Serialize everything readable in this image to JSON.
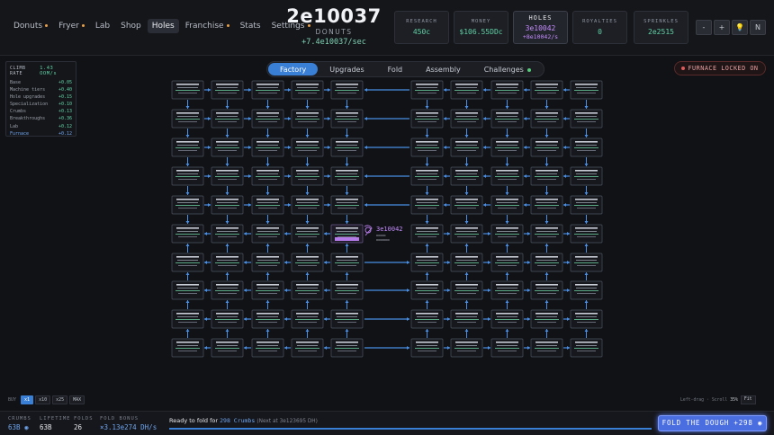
{
  "nav": [
    {
      "label": "Donuts",
      "dot": true
    },
    {
      "label": "Fryer",
      "dot": true
    },
    {
      "label": "Lab",
      "dot": false
    },
    {
      "label": "Shop",
      "dot": false
    },
    {
      "label": "Holes",
      "dot": false,
      "active": true
    },
    {
      "label": "Franchise",
      "dot": true
    },
    {
      "label": "Stats",
      "dot": false
    },
    {
      "label": "Settings",
      "dot": true
    }
  ],
  "counter": {
    "value": "2e10037",
    "unit": "DONUTS",
    "rate": "+7.4e10037/sec"
  },
  "stats": {
    "research": {
      "label": "RESEARCH",
      "value": "450c"
    },
    "money": {
      "label": "MONEY",
      "value": "$106.55DDc"
    },
    "holes": {
      "label": "HOLES",
      "value": "3e10042",
      "sub": "+8e10042/s"
    },
    "royalties": {
      "label": "ROYALTIES",
      "value": "0"
    },
    "sprinkles": {
      "label": "SPRINKLES",
      "value": "2e2515"
    }
  },
  "controls": [
    "-",
    "+",
    "💡",
    "N"
  ],
  "tabs": [
    {
      "label": "Factory",
      "active": true
    },
    {
      "label": "Upgrades"
    },
    {
      "label": "Fold"
    },
    {
      "label": "Assembly"
    },
    {
      "label": "Challenges",
      "dot": true
    }
  ],
  "furnace": {
    "label": "FURNACE LOCKED ON"
  },
  "climb": {
    "title": "CLIMB RATE",
    "rate": "1.43 OOM/s",
    "rows": [
      {
        "k": "Base",
        "v": "+0.05"
      },
      {
        "k": "Machine tiers",
        "v": "+0.40"
      },
      {
        "k": "Hole upgrades",
        "v": "+0.15"
      },
      {
        "k": "Specialization",
        "v": "+0.10"
      },
      {
        "k": "Crumbs",
        "v": "+0.13"
      },
      {
        "k": "Breakthroughs",
        "v": "+0.36"
      },
      {
        "k": "Lab",
        "v": "+0.12"
      },
      {
        "k": "Furnace",
        "v": "+0.12",
        "hl": true
      }
    ]
  },
  "center": {
    "value": "3e10042"
  },
  "buy": {
    "label": "BUY",
    "options": [
      "x1",
      "x10",
      "x25",
      "MAX"
    ],
    "active": "x1"
  },
  "view": {
    "left_drag": "Left-drag",
    "scroll": "Scroll",
    "zoom": "35%",
    "fit": "Fit"
  },
  "bottom": {
    "crumbs": {
      "label": "CRUMBS",
      "value": "63B"
    },
    "lifetime": {
      "label": "LIFETIME",
      "value": "63B"
    },
    "folds": {
      "label": "FOLDS",
      "value": "26"
    },
    "fold_bonus": {
      "label": "FOLD BONUS",
      "value": "×3.13e274 DH/s"
    },
    "ready_text": "Ready to fold for",
    "ready_crumbs": "298 Crumbs",
    "ready_next": "(Next at 3e123695 DH)",
    "progress": 1.0,
    "fold_button": "FOLD THE DOUGH +298"
  },
  "colors": {
    "accent": "#3a7fd6",
    "green": "#5fd1a3",
    "purple": "#c48bff",
    "danger": "#e05a5a"
  }
}
